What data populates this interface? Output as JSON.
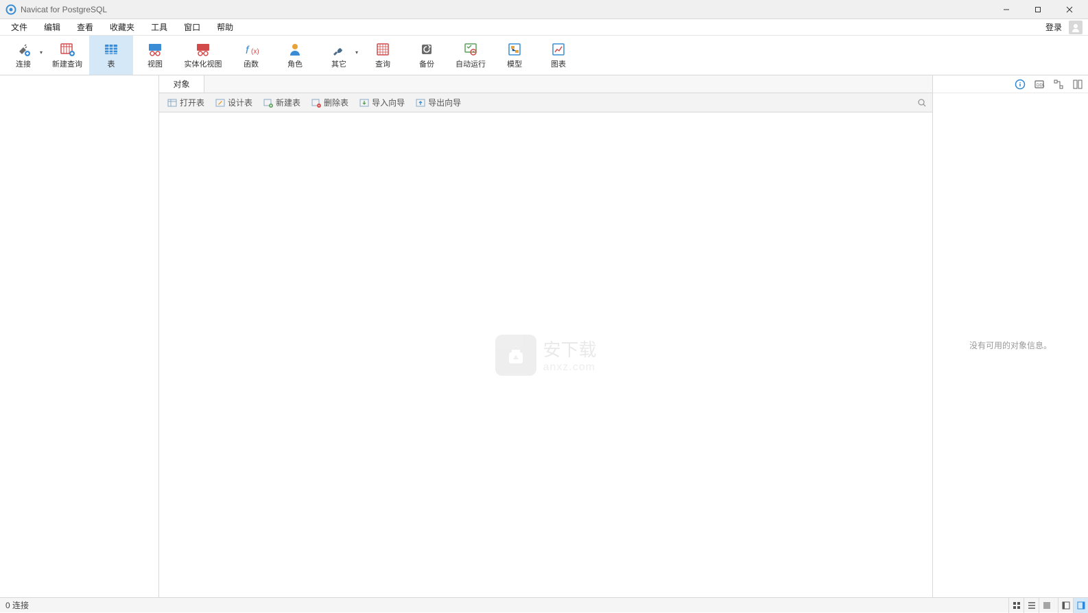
{
  "title": "Navicat for PostgreSQL",
  "menubar": {
    "items": [
      "文件",
      "编辑",
      "查看",
      "收藏夹",
      "工具",
      "窗口",
      "帮助"
    ],
    "login": "登录"
  },
  "toolbar": {
    "items": [
      {
        "id": "connect",
        "label": "连接",
        "dropdown": true
      },
      {
        "id": "new-query",
        "label": "新建查询"
      },
      {
        "id": "table",
        "label": "表",
        "active": true
      },
      {
        "id": "view",
        "label": "视图"
      },
      {
        "id": "materialized-view",
        "label": "实体化视图",
        "wide": true
      },
      {
        "id": "function",
        "label": "函数"
      },
      {
        "id": "role",
        "label": "角色"
      },
      {
        "id": "other",
        "label": "其它",
        "dropdown": true
      },
      {
        "id": "query",
        "label": "查询"
      },
      {
        "id": "backup",
        "label": "备份"
      },
      {
        "id": "automation",
        "label": "自动运行"
      },
      {
        "id": "model",
        "label": "模型"
      },
      {
        "id": "chart",
        "label": "图表"
      }
    ]
  },
  "center": {
    "tab": "对象",
    "subtoolbar": [
      "打开表",
      "设计表",
      "新建表",
      "删除表",
      "导入向导",
      "导出向导"
    ],
    "watermark": {
      "line1": "安下载",
      "line2": "anxz.com"
    }
  },
  "right": {
    "empty": "没有可用的对象信息。"
  },
  "status": {
    "left": "0 连接"
  }
}
